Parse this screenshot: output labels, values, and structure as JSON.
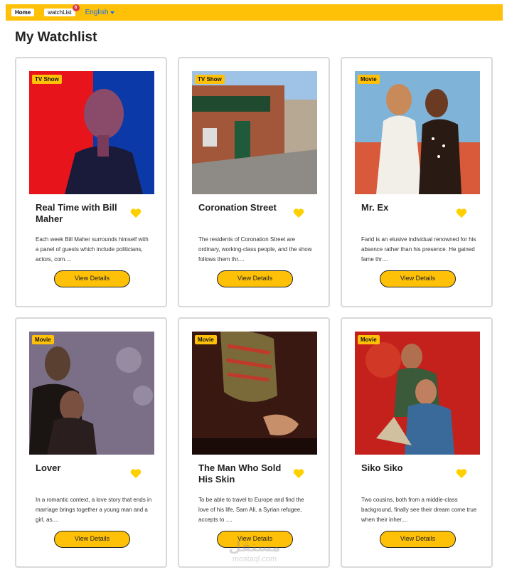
{
  "navbar": {
    "home_label": "Home",
    "watchlist_label": "watchList",
    "watchlist_count": "6",
    "language_label": "English"
  },
  "page": {
    "title": "My Watchlist"
  },
  "cards": [
    {
      "badge": "TV Show",
      "title": "Real Time with Bill Maher",
      "description": "Each week Bill Maher surrounds himself with a panel of guests which include politicians, actors, com....",
      "button": "View Details"
    },
    {
      "badge": "TV Show",
      "title": "Coronation Street",
      "description": "The residents of Coronation Street are ordinary, working-class people, and the show follows them thr....",
      "button": "View Details"
    },
    {
      "badge": "Movie",
      "title": "Mr. Ex",
      "description": "Farid is an elusive individual renowned for his absence rather than his presence. He gained fame thr....",
      "button": "View Details"
    },
    {
      "badge": "Movie",
      "title": "Lover",
      "description": "In a romantic context, a love story that ends in marriage brings together a young man and a girl, as....",
      "button": "View Details"
    },
    {
      "badge": "Movie",
      "title": "The Man Who Sold His Skin",
      "description": "To be able to travel to Europe and find the love of his life, Sam Ali, a Syrian refugee, accepts to ....",
      "button": "View Details"
    },
    {
      "badge": "Movie",
      "title": "Siko Siko",
      "description": "Two cousins, both from a middle-class background, finally see their dream come true when their inher....",
      "button": "View Details"
    }
  ],
  "watermark": {
    "text_ar": "مستقل",
    "text_en": "mostaql.com"
  },
  "colors": {
    "accent": "#ffc107",
    "heart": "#ffd000",
    "link": "#0d6efd"
  }
}
